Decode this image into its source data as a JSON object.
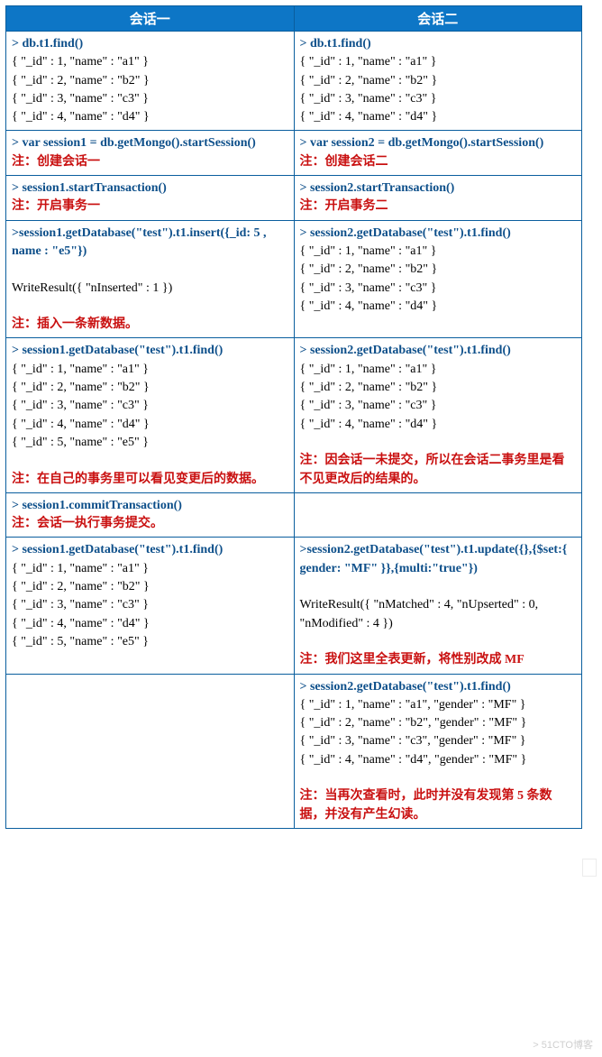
{
  "headers": {
    "col1": "会话一",
    "col2": "会话二"
  },
  "rows": [
    {
      "left": {
        "cmd": "> db.t1.find()",
        "out": [
          "{ \"_id\" : 1, \"name\" : \"a1\" }",
          "{ \"_id\" : 2, \"name\" : \"b2\" }",
          "{ \"_id\" : 3, \"name\" : \"c3\" }",
          "{ \"_id\" : 4, \"name\" : \"d4\" }"
        ],
        "note": ""
      },
      "right": {
        "cmd": "> db.t1.find()",
        "out": [
          "{ \"_id\" : 1, \"name\" : \"a1\" }",
          "{ \"_id\" : 2, \"name\" : \"b2\" }",
          "{ \"_id\" : 3, \"name\" : \"c3\" }",
          "{ \"_id\" : 4, \"name\" : \"d4\" }"
        ],
        "note": ""
      }
    },
    {
      "left": {
        "cmd": "> var session1 = db.getMongo().startSession()",
        "out": [],
        "note": "注：创建会话一"
      },
      "right": {
        "cmd": "> var session2 = db.getMongo().startSession()",
        "out": [],
        "note": "注：创建会话二"
      }
    },
    {
      "left": {
        "cmd": "> session1.startTransaction()",
        "out": [],
        "note": "注：开启事务一"
      },
      "right": {
        "cmd": "> session2.startTransaction()",
        "out": [],
        "note": "注：开启事务二"
      }
    },
    {
      "left": {
        "cmd": ">session1.getDatabase(\"test\").t1.insert({_id: 5 , name : \"e5\"})",
        "out": [
          "",
          "WriteResult({ \"nInserted\" : 1 })",
          ""
        ],
        "note": "注：插入一条新数据。"
      },
      "right": {
        "cmd": "> session2.getDatabase(\"test\").t1.find()",
        "out": [
          "{ \"_id\" : 1, \"name\" : \"a1\" }",
          "{ \"_id\" : 2, \"name\" : \"b2\" }",
          "{ \"_id\" : 3, \"name\" : \"c3\" }",
          "{ \"_id\" : 4, \"name\" : \"d4\" }"
        ],
        "note": ""
      }
    },
    {
      "left": {
        "cmd": "> session1.getDatabase(\"test\").t1.find()",
        "out": [
          "{ \"_id\" : 1, \"name\" : \"a1\" }",
          "{ \"_id\" : 2, \"name\" : \"b2\" }",
          "{ \"_id\" : 3, \"name\" : \"c3\" }",
          "{ \"_id\" : 4, \"name\" : \"d4\" }",
          "{ \"_id\" : 5, \"name\" : \"e5\" }",
          ""
        ],
        "note": "注：在自己的事务里可以看见变更后的数据。"
      },
      "right": {
        "cmd": "> session2.getDatabase(\"test\").t1.find()",
        "out": [
          "{ \"_id\" : 1, \"name\" : \"a1\" }",
          "{ \"_id\" : 2, \"name\" : \"b2\" }",
          "{ \"_id\" : 3, \"name\" : \"c3\" }",
          "{ \"_id\" : 4, \"name\" : \"d4\" }",
          ""
        ],
        "note": "注：因会话一未提交，所以在会话二事务里是看不见更改后的结果的。"
      }
    },
    {
      "left": {
        "cmd": "> session1.commitTransaction()",
        "out": [],
        "note": "注：会话一执行事务提交。"
      },
      "right": {
        "cmd": "",
        "out": [],
        "note": ""
      }
    },
    {
      "left": {
        "cmd": "> session1.getDatabase(\"test\").t1.find()",
        "out": [
          "{ \"_id\" : 1, \"name\" : \"a1\" }",
          "{ \"_id\" : 2, \"name\" : \"b2\" }",
          "{ \"_id\" : 3, \"name\" : \"c3\" }",
          "{ \"_id\" : 4, \"name\" : \"d4\" }",
          "{ \"_id\" : 5, \"name\" : \"e5\" }"
        ],
        "note": ""
      },
      "right": {
        "cmd": ">session2.getDatabase(\"test\").t1.update({},{$set:{ gender: \"MF\" }},{multi:\"true\"})",
        "out": [
          "",
          "WriteResult({ \"nMatched\" : 4, \"nUpserted\" : 0, \"nModified\" : 4 })",
          ""
        ],
        "note": "注：我们这里全表更新，将性别改成 MF"
      }
    },
    {
      "left": {
        "cmd": "",
        "out": [],
        "note": ""
      },
      "right": {
        "cmd": "> session2.getDatabase(\"test\").t1.find()",
        "out": [
          "{ \"_id\" : 1, \"name\" : \"a1\", \"gender\" : \"MF\" }",
          "{ \"_id\" : 2, \"name\" : \"b2\", \"gender\" : \"MF\" }",
          "{ \"_id\" : 3, \"name\" : \"c3\", \"gender\" : \"MF\" }",
          "{ \"_id\" : 4, \"name\" : \"d4\", \"gender\" : \"MF\" }",
          ""
        ],
        "note": "注：当再次查看时，此时并没有发现第 5 条数据，并没有产生幻读。"
      }
    }
  ],
  "watermark": "> 51CTO博客"
}
